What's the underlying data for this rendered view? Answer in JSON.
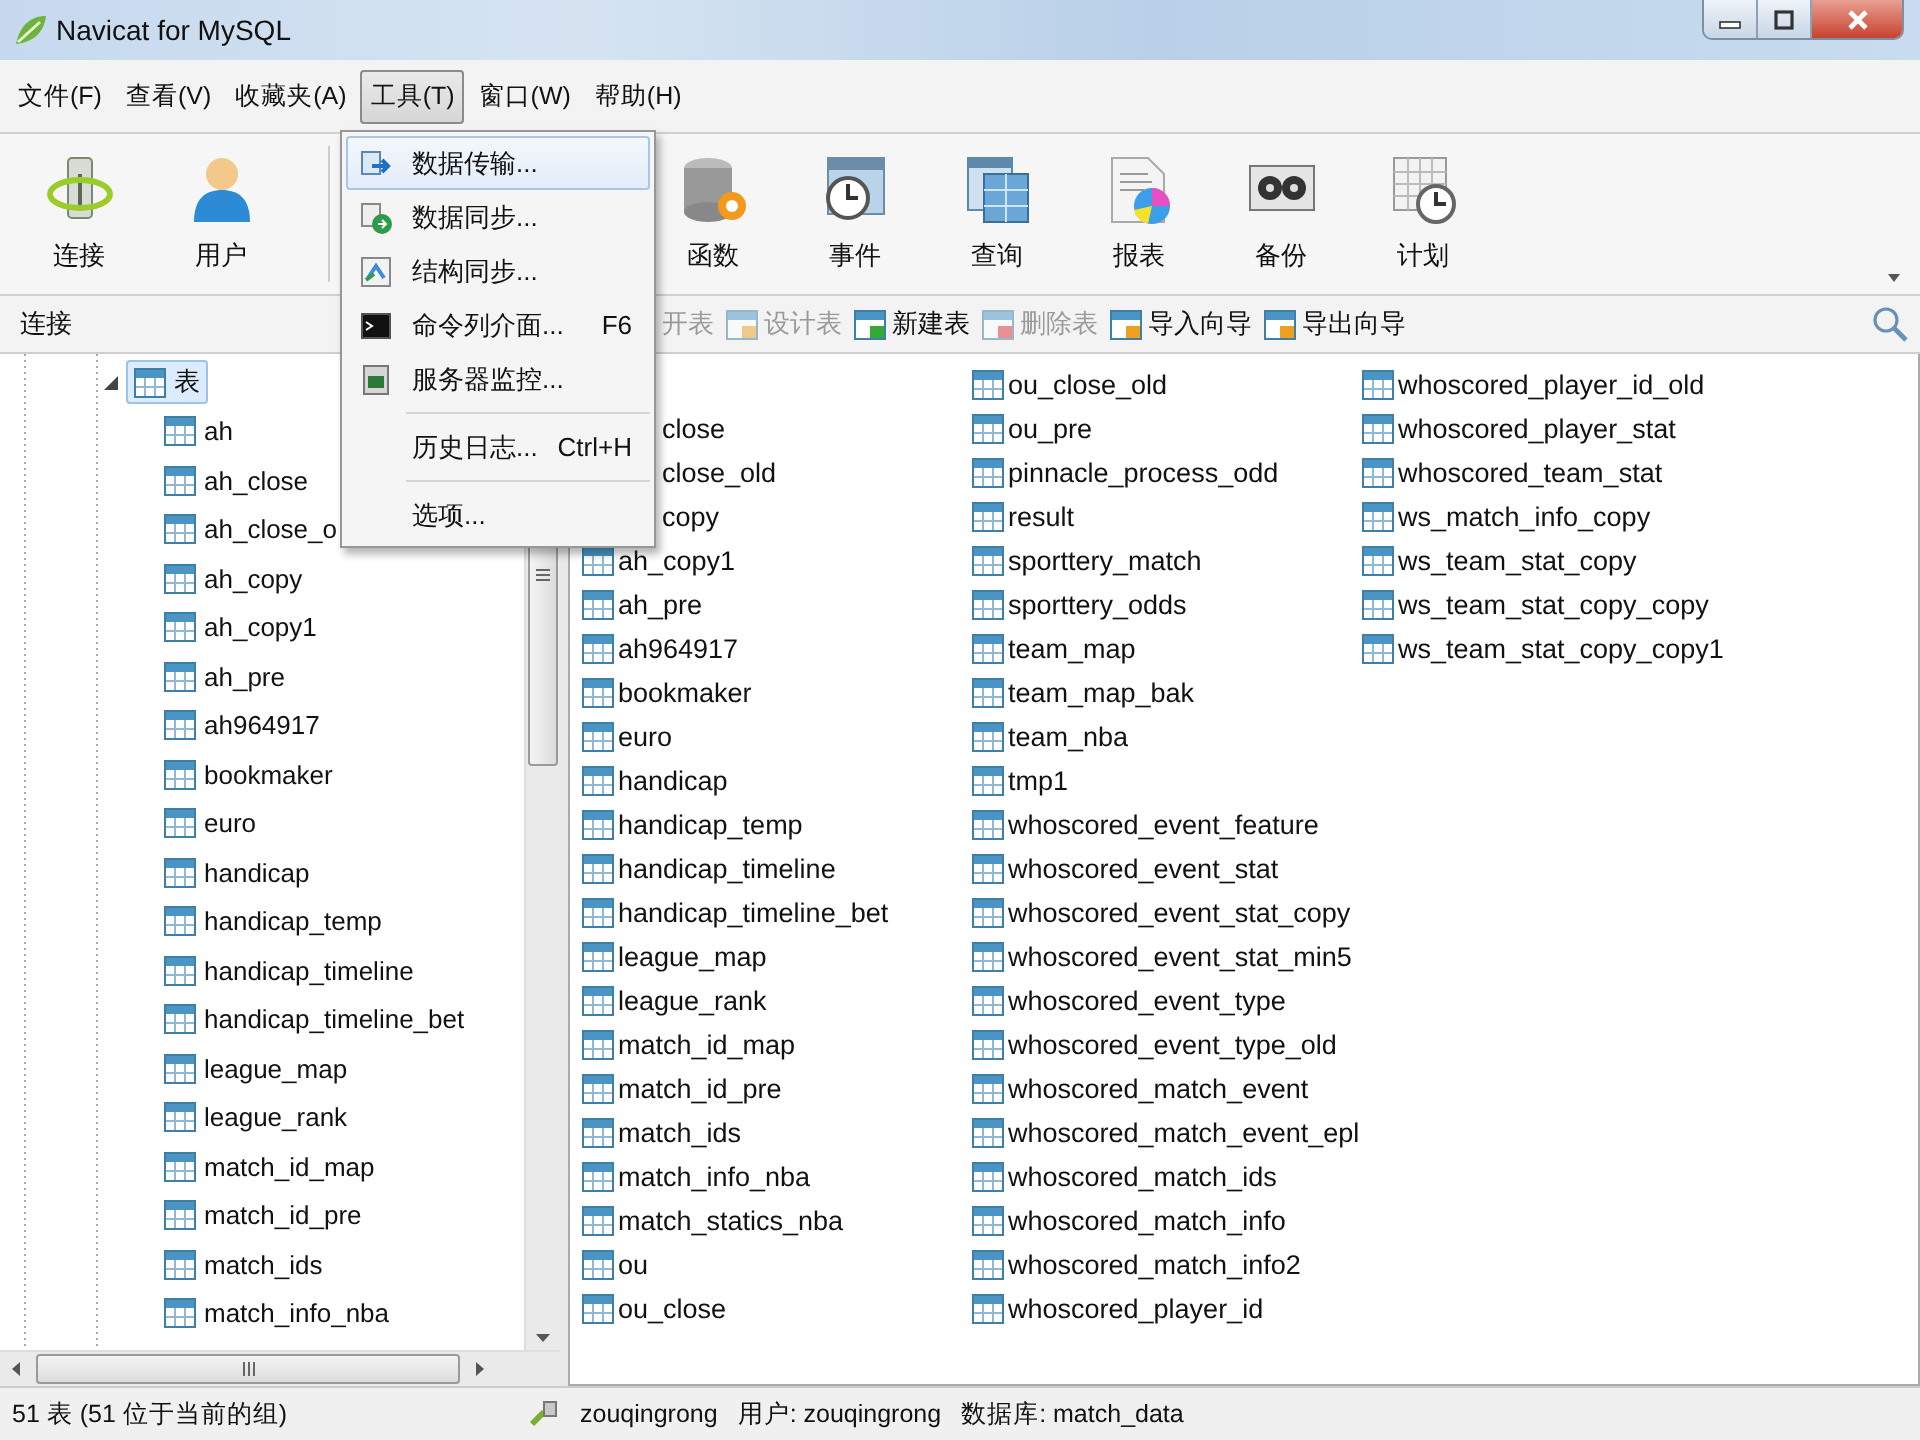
{
  "window": {
    "title": "Navicat for MySQL"
  },
  "menu_bar": [
    {
      "label": "文件(F)",
      "selected": false
    },
    {
      "label": "查看(V)",
      "selected": false
    },
    {
      "label": "收藏夹(A)",
      "selected": false
    },
    {
      "label": "工具(T)",
      "selected": true
    },
    {
      "label": "窗口(W)",
      "selected": false
    },
    {
      "label": "帮助(H)",
      "selected": false
    }
  ],
  "tools_menu": [
    {
      "kind": "item",
      "label": "数据传输...",
      "selected": true
    },
    {
      "kind": "item",
      "label": "数据同步...",
      "selected": false
    },
    {
      "kind": "item",
      "label": "结构同步...",
      "selected": false
    },
    {
      "kind": "item",
      "label": "命令列介面...",
      "shortcut": "F6",
      "selected": false
    },
    {
      "kind": "item",
      "label": "服务器监控...",
      "selected": false
    },
    {
      "kind": "separator"
    },
    {
      "kind": "item",
      "label": "历史日志...",
      "shortcut": "Ctrl+H",
      "selected": false
    },
    {
      "kind": "separator"
    },
    {
      "kind": "item",
      "label": "选项...",
      "selected": false
    }
  ],
  "toolbar_left": [
    {
      "label": "连接"
    },
    {
      "label": "用户"
    }
  ],
  "toolbar_right": [
    {
      "label": "函数"
    },
    {
      "label": "事件"
    },
    {
      "label": "查询"
    },
    {
      "label": "报表"
    },
    {
      "label": "备份"
    },
    {
      "label": "计划"
    }
  ],
  "object_bar": {
    "section": "连接",
    "buttons": [
      {
        "label": "开表",
        "disabled": true
      },
      {
        "label": "设计表",
        "disabled": true
      },
      {
        "label": "新建表",
        "disabled": false
      },
      {
        "label": "删除表",
        "disabled": true
      },
      {
        "label": "导入向导",
        "disabled": false
      },
      {
        "label": "导出向导",
        "disabled": false
      }
    ]
  },
  "tree": [
    {
      "label": "表",
      "selected": true,
      "expanded": true,
      "children": [
        {
          "label": "ah"
        },
        {
          "label": "ah_close"
        },
        {
          "label": "ah_close_o"
        },
        {
          "label": "ah_copy"
        },
        {
          "label": "ah_copy1"
        },
        {
          "label": "ah_pre"
        },
        {
          "label": "ah964917"
        },
        {
          "label": "bookmaker"
        },
        {
          "label": "euro"
        },
        {
          "label": "handicap"
        },
        {
          "label": "handicap_temp"
        },
        {
          "label": "handicap_timeline"
        },
        {
          "label": "handicap_timeline_bet"
        },
        {
          "label": "league_map"
        },
        {
          "label": "league_rank"
        },
        {
          "label": "match_id_map"
        },
        {
          "label": "match_id_pre"
        },
        {
          "label": "match_ids"
        },
        {
          "label": "match_info_nba"
        }
      ]
    }
  ],
  "object_list": [
    [
      {
        "kind": "covered"
      },
      {
        "kind": "partial",
        "label": "close"
      },
      {
        "kind": "partial",
        "label": "close_old"
      },
      {
        "kind": "partial",
        "label": "copy"
      },
      {
        "kind": "table",
        "label": "ah_copy1"
      },
      {
        "kind": "table",
        "label": "ah_pre"
      },
      {
        "kind": "table",
        "label": "ah964917"
      },
      {
        "kind": "table",
        "label": "bookmaker"
      },
      {
        "kind": "table",
        "label": "euro"
      },
      {
        "kind": "table",
        "label": "handicap"
      },
      {
        "kind": "table",
        "label": "handicap_temp"
      },
      {
        "kind": "table",
        "label": "handicap_timeline"
      },
      {
        "kind": "table",
        "label": "handicap_timeline_bet"
      },
      {
        "kind": "table",
        "label": "league_map"
      },
      {
        "kind": "table",
        "label": "league_rank"
      },
      {
        "kind": "table",
        "label": "match_id_map"
      },
      {
        "kind": "table",
        "label": "match_id_pre"
      },
      {
        "kind": "table",
        "label": "match_ids"
      },
      {
        "kind": "table",
        "label": "match_info_nba"
      },
      {
        "kind": "table",
        "label": "match_statics_nba"
      },
      {
        "kind": "table",
        "label": "ou"
      },
      {
        "kind": "table",
        "label": "ou_close"
      }
    ],
    [
      {
        "kind": "table",
        "label": "ou_close_old"
      },
      {
        "kind": "table",
        "label": "ou_pre"
      },
      {
        "kind": "table",
        "label": "pinnacle_process_odd"
      },
      {
        "kind": "table",
        "label": "result"
      },
      {
        "kind": "table",
        "label": "sporttery_match"
      },
      {
        "kind": "table",
        "label": "sporttery_odds"
      },
      {
        "kind": "table",
        "label": "team_map"
      },
      {
        "kind": "table",
        "label": "team_map_bak"
      },
      {
        "kind": "table",
        "label": "team_nba"
      },
      {
        "kind": "table",
        "label": "tmp1"
      },
      {
        "kind": "table",
        "label": "whoscored_event_feature"
      },
      {
        "kind": "table",
        "label": "whoscored_event_stat"
      },
      {
        "kind": "table",
        "label": "whoscored_event_stat_copy"
      },
      {
        "kind": "table",
        "label": "whoscored_event_stat_min5"
      },
      {
        "kind": "table",
        "label": "whoscored_event_type"
      },
      {
        "kind": "table",
        "label": "whoscored_event_type_old"
      },
      {
        "kind": "table",
        "label": "whoscored_match_event"
      },
      {
        "kind": "table",
        "label": "whoscored_match_event_epl"
      },
      {
        "kind": "table",
        "label": "whoscored_match_ids"
      },
      {
        "kind": "table",
        "label": "whoscored_match_info"
      },
      {
        "kind": "table",
        "label": "whoscored_match_info2"
      },
      {
        "kind": "table",
        "label": "whoscored_player_id"
      }
    ],
    [
      {
        "kind": "table",
        "label": "whoscored_player_id_old"
      },
      {
        "kind": "table",
        "label": "whoscored_player_stat"
      },
      {
        "kind": "table",
        "label": "whoscored_team_stat"
      },
      {
        "kind": "table",
        "label": "ws_match_info_copy"
      },
      {
        "kind": "table",
        "label": "ws_team_stat_copy"
      },
      {
        "kind": "table",
        "label": "ws_team_stat_copy_copy"
      },
      {
        "kind": "table",
        "label": "ws_team_stat_copy_copy1"
      }
    ]
  ],
  "status_bar": {
    "count": "51 表 (51 位于当前的组)",
    "connection": "zouqingrong",
    "user": "用户: zouqingrong",
    "database": "数据库: match_data"
  }
}
